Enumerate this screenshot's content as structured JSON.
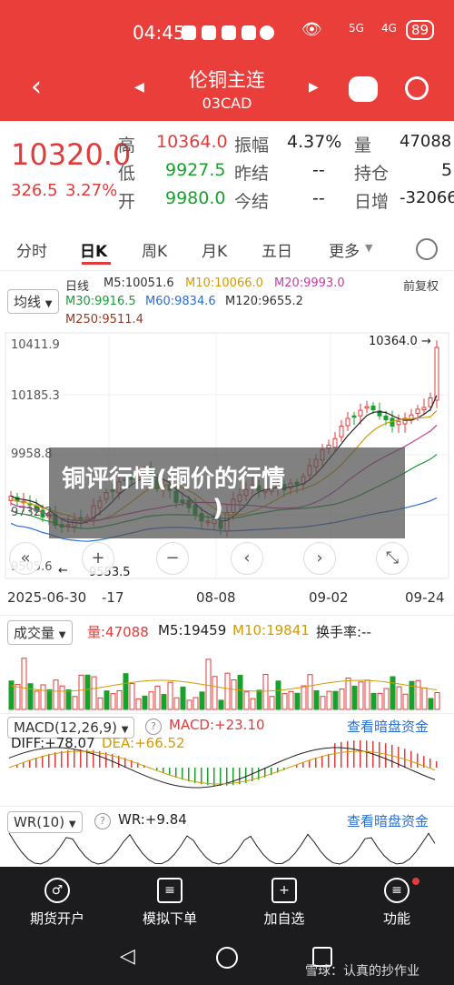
{
  "status": {
    "time": "04:45",
    "signal": "5G",
    "signal2": "4G",
    "battery": "89"
  },
  "header": {
    "title": "伦铜主连",
    "subtitle": "03CAD"
  },
  "quote": {
    "price": "10320.0",
    "change": "326.5",
    "change_pct": "3.27%",
    "high_label": "高",
    "high": "10364.0",
    "low_label": "低",
    "low": "9927.5",
    "open_label": "开",
    "open": "9980.0",
    "amp_label": "振幅",
    "amp": "4.37%",
    "prevsettle_label": "昨结",
    "prevsettle": "--",
    "settle_label": "今结",
    "settle": "--",
    "vol_label": "量",
    "vol": "47088",
    "oi_label": "持仓",
    "oi": "5",
    "oichg_label": "日增",
    "oichg": "-32066"
  },
  "tabs": [
    "分时",
    "日K",
    "周K",
    "月K",
    "五日",
    "更多"
  ],
  "kline": {
    "selector": "均线",
    "period": "日线",
    "adjust": "前复权",
    "ma5": "M5:10051.6",
    "ma10": "M10:10066.0",
    "ma20": "M20:9993.0",
    "ma30": "M30:9916.5",
    "ma60": "M60:9834.6",
    "ma120": "M120:9655.2",
    "ma250": "M250:9511.4",
    "y_top": "10411.9",
    "y_mid": "10185.3",
    "y_3": "9958.8",
    "y_4": "9732.2",
    "y_5": "9505.6",
    "max_mark": "10364.0",
    "min_mark": "9553.5",
    "dates": [
      "2025-06-30",
      "-17",
      "08-08",
      "09-02",
      "09-24"
    ]
  },
  "overlay": {
    "text1": "铜评行情(铜价的行情",
    "text2": ")"
  },
  "volume": {
    "selector": "成交量",
    "vol": "量:47088",
    "ma5": "M5:19459",
    "ma10": "M10:19841",
    "turnover": "换手率:--"
  },
  "macd": {
    "selector": "MACD(12,26,9)",
    "macd": "MACD:+23.10",
    "diff": "DIFF:+78.07",
    "dea": "DEA:+66.52",
    "link": "查看暗盘资金"
  },
  "wr": {
    "selector": "WR(10)",
    "wr": "WR:+9.84",
    "link": "查看暗盘资金"
  },
  "nav": [
    "期货开户",
    "模拟下单",
    "加自选",
    "功能"
  ],
  "watermark": "雪球：认真的抄作业",
  "colors": {
    "header": "#ea3e3b",
    "up": "#e23b3b",
    "down": "#1aa02c"
  }
}
